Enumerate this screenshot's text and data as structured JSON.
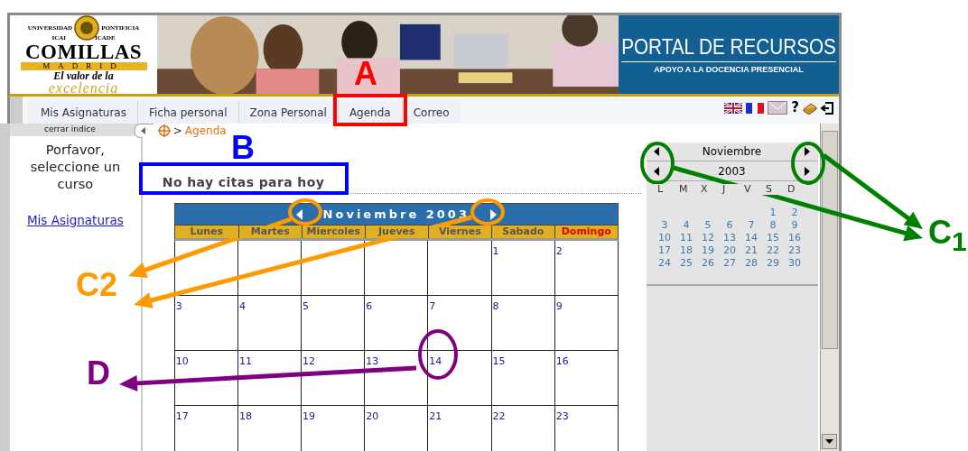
{
  "header": {
    "logo": {
      "top_left": "UNIVERSIDAD",
      "top_right": "PONTIFICIA",
      "left_school": "ICAI",
      "right_school": "ICADE",
      "name": "COMILLAS",
      "city": "MADRID",
      "motto": "El valor de la",
      "motto_big": "excelencia"
    },
    "banner": {
      "title": "PORTAL DE RECURSOS",
      "subtitle": "APOYO A LA DOCENCIA PRESENCIAL"
    }
  },
  "tabs": [
    {
      "label": "Mis Asignaturas"
    },
    {
      "label": "Ficha personal"
    },
    {
      "label": "Zona Personal"
    },
    {
      "label": "Agenda"
    },
    {
      "label": "Correo"
    }
  ],
  "toolbar": {
    "help": "?"
  },
  "sidebar": {
    "close_tab": "cerrar indice",
    "message": "Porfavor, seleccione un curso",
    "link": "Mis Asignaturas"
  },
  "breadcrumb": {
    "separator": ">",
    "current": "Agenda"
  },
  "notice": "No hay citas para hoy",
  "calendar": {
    "title": "Noviembre 2003",
    "weekdays": [
      {
        "label": "Lunes",
        "holiday": false
      },
      {
        "label": "Martes",
        "holiday": false
      },
      {
        "label": "Miercoles",
        "holiday": false
      },
      {
        "label": "Jueves",
        "holiday": false
      },
      {
        "label": "Viernes",
        "holiday": false
      },
      {
        "label": "Sabado",
        "holiday": false
      },
      {
        "label": "Domingo",
        "holiday": true
      }
    ],
    "weeks": [
      [
        "1",
        "2"
      ],
      [
        "3",
        "4",
        "5",
        "6",
        "7",
        "8",
        "9"
      ],
      [
        "10",
        "11",
        "12",
        "13",
        "14",
        "15",
        "16"
      ],
      [
        "17",
        "18",
        "19",
        "20",
        "21",
        "22",
        "23"
      ]
    ]
  },
  "mini_calendar": {
    "month": "Noviembre",
    "year": "2003",
    "weekday_letters": [
      "L",
      "M",
      "X",
      "J",
      "V",
      "S",
      "D"
    ],
    "weeks": [
      [
        "1",
        "2"
      ],
      [
        "3",
        "4",
        "5",
        "6",
        "7",
        "8",
        "9"
      ],
      [
        "10",
        "11",
        "12",
        "13",
        "14",
        "15",
        "16"
      ],
      [
        "17",
        "18",
        "19",
        "20",
        "21",
        "22",
        "23"
      ],
      [
        "24",
        "25",
        "26",
        "27",
        "28",
        "29",
        "30"
      ]
    ]
  },
  "annotations": [
    {
      "label": "A",
      "color": "#ff0000"
    },
    {
      "label": "B",
      "color": "#0000ff"
    },
    {
      "label": "C$_{1}$",
      "color": "#008000"
    },
    {
      "label": "C2",
      "color": "#ff9900"
    },
    {
      "label": "D",
      "color": "#800080"
    }
  ]
}
